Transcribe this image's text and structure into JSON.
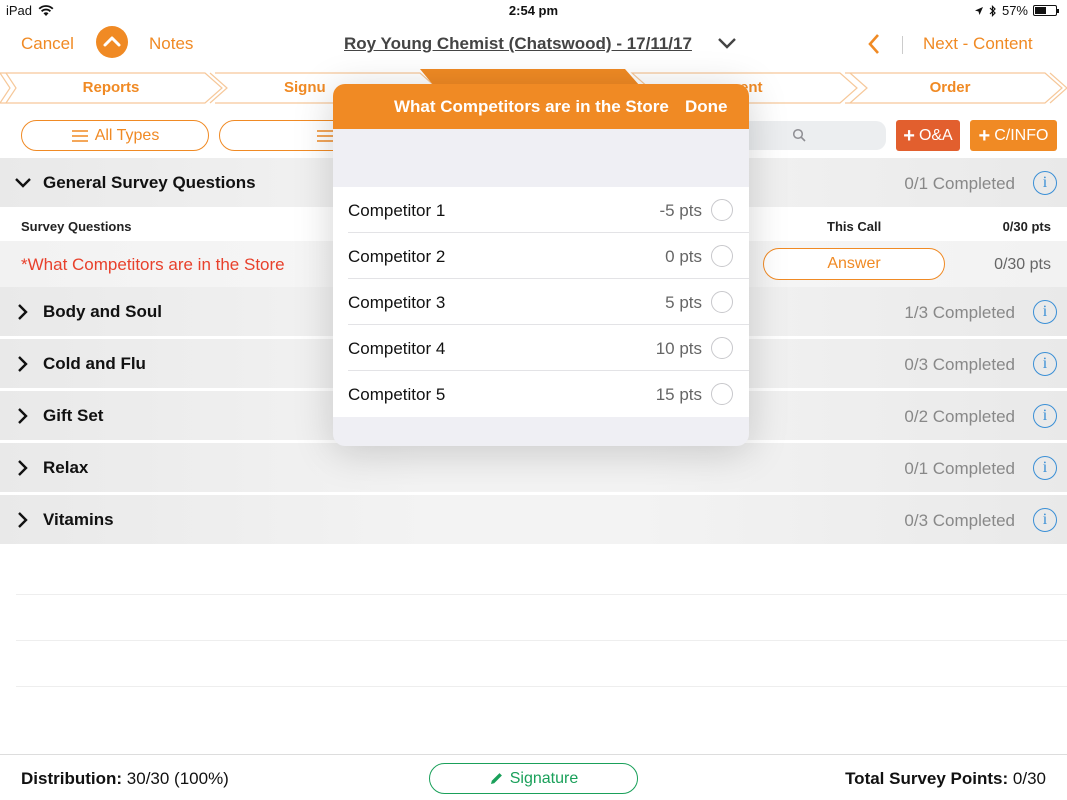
{
  "status_bar": {
    "device": "iPad",
    "time": "2:54 pm",
    "battery": "57%",
    "battery_level": 0.57
  },
  "nav": {
    "cancel": "Cancel",
    "notes": "Notes",
    "title": "Roy Young Chemist (Chatswood) - 17/11/17",
    "next": "Next - Content"
  },
  "steps": [
    "Reports",
    "Signu",
    "ent",
    "Order"
  ],
  "filters": {
    "all_types": "All Types",
    "qa": "O&A",
    "cinfo": "C/INFO"
  },
  "sections": [
    {
      "name": "General Survey Questions",
      "completed": "0/1 Completed",
      "expanded": true
    },
    {
      "name": "Body and Soul",
      "completed": "1/3 Completed"
    },
    {
      "name": "Cold and Flu",
      "completed": "0/3 Completed"
    },
    {
      "name": "Gift Set",
      "completed": "0/2 Completed"
    },
    {
      "name": "Relax",
      "completed": "0/1 Completed"
    },
    {
      "name": "Vitamins",
      "completed": "0/3 Completed"
    }
  ],
  "sub_header": {
    "survey_questions": "Survey Questions",
    "this_call": "This Call",
    "pts": "0/30 pts"
  },
  "question": {
    "text": "*What Competitors are in the Store",
    "answer": "Answer",
    "pts": "0/30 pts"
  },
  "popover": {
    "title": "What Competitors are in the Store",
    "done": "Done",
    "items": [
      {
        "name": "Competitor 1",
        "pts": "-5 pts"
      },
      {
        "name": "Competitor 2",
        "pts": "0 pts"
      },
      {
        "name": "Competitor 3",
        "pts": "5 pts"
      },
      {
        "name": "Competitor 4",
        "pts": "10 pts"
      },
      {
        "name": "Competitor 5",
        "pts": "15 pts"
      }
    ]
  },
  "bottom": {
    "distribution_label": "Distribution:",
    "distribution_value": "30/30 (100%)",
    "signature": "Signature",
    "total_label": "Total Survey Points:",
    "total_value": "0/30"
  },
  "colors": {
    "accent": "#f08a24",
    "red": "#e8412c",
    "qa_btn": "#e25f2e",
    "green": "#1aa05a",
    "info_blue": "#3a8fd6"
  }
}
